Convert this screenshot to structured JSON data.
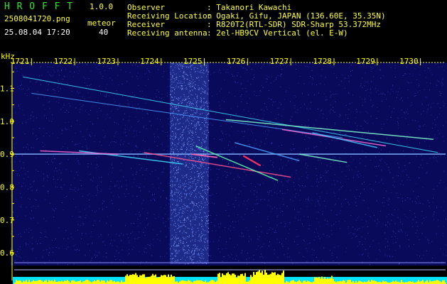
{
  "header": {
    "app_name": "H R O F F T",
    "version": "1.0.0",
    "filename": "2508041720.png",
    "datetime": "25.08.04 17:20",
    "meteor_label": "meteor",
    "meteor_count": "40",
    "observer_label": "Observer",
    "observer_value": ": Takanori Kawachi",
    "location_label": "Receiving Location",
    "location_value": ": Ogaki, Gifu, JAPAN (136.60E, 35.35N)",
    "receiver_label": "Receiver",
    "receiver_value": ": R820T2(RTL-SDR) SDR-Sharp 53.372MHz",
    "antenna_label": "Receiving antenna",
    "antenna_value": ": 2el-HB9CV Vertical (el. E-W)"
  },
  "colors": {
    "background": "#000000",
    "plot_background": "#0a0a5a",
    "header_green": "#2ee82e",
    "header_yellow": "#ffff40",
    "grid_yellow": "#ffff00",
    "bottom_band_cyan": "#00e5ff",
    "bottom_peaks_yellow": "#ffff00"
  },
  "chart_data": {
    "type": "heatmap",
    "ylabel": "kHz",
    "x_ticks": [
      "1721",
      "1722",
      "1723",
      "1724",
      "1725",
      "1726",
      "1727",
      "1728",
      "1729",
      "1730"
    ],
    "y_ticks": [
      "1.1",
      "1.0",
      "0.9",
      "0.8",
      "0.7",
      "0.6"
    ],
    "xlim": [
      1720.6,
      1730.5
    ],
    "ylim": [
      0.57,
      1.17
    ],
    "carrier_khz": 0.9,
    "noise_burst_x": [
      1724.2,
      1725.1
    ],
    "traces": [
      {
        "x": [
          1720.8,
          1730.4
        ],
        "y": [
          1.135,
          0.905
        ]
      },
      {
        "x": [
          1721.0,
          1728.2
        ],
        "y": [
          1.085,
          0.95
        ]
      },
      {
        "x": [
          1725.5,
          1730.3
        ],
        "y": [
          1.005,
          0.945
        ]
      },
      {
        "x": [
          1726.8,
          1729.2
        ],
        "y": [
          0.975,
          0.925
        ]
      },
      {
        "x": [
          1727.5,
          1729.0
        ],
        "y": [
          0.965,
          0.92
        ]
      },
      {
        "x": [
          1723.6,
          1727.0
        ],
        "y": [
          0.905,
          0.83
        ]
      },
      {
        "x": [
          1724.8,
          1726.7
        ],
        "y": [
          0.925,
          0.82
        ]
      },
      {
        "x": [
          1722.1,
          1724.5
        ],
        "y": [
          0.91,
          0.87
        ]
      },
      {
        "x": [
          1725.7,
          1727.2
        ],
        "y": [
          0.935,
          0.88
        ]
      },
      {
        "x": [
          1727.2,
          1728.3
        ],
        "y": [
          0.9,
          0.875
        ]
      },
      {
        "x": [
          1721.2,
          1723.0
        ],
        "y": [
          0.91,
          0.9
        ]
      }
    ]
  }
}
